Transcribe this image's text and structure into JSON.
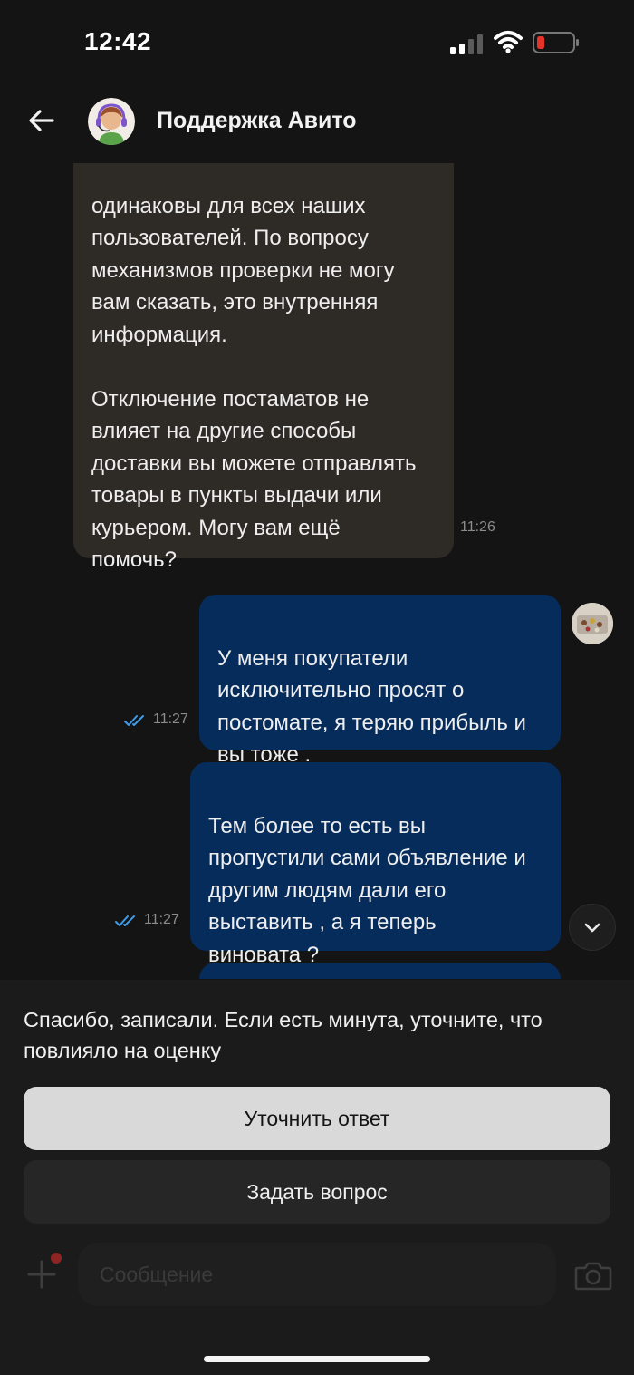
{
  "status_bar": {
    "time": "12:42"
  },
  "header": {
    "title": "Поддержка Авито"
  },
  "messages": [
    {
      "direction": "incoming",
      "text": "одинаковы для всех наших\nпользователей. По вопросу\nмеханизмов проверки не могу\nвам сказать, это внутренняя\nинформация.\n\nОтключение постаматов не\nвлияет на другие способы\nдоставки вы можете отправлять\nтовары в пункты выдачи или\nкурьером. Могу вам ещё\nпомочь?",
      "time": "11:26"
    },
    {
      "direction": "outgoing",
      "text": "У меня покупатели\nисключительно просят о\nпостомате, я теряю прибыль и\nвы тоже .",
      "time": "11:27"
    },
    {
      "direction": "outgoing",
      "text": "Тем более то есть вы\nпропустили сами объявление и\nдругим людям дали его\nвыставить , а я теперь\nвиновата ?",
      "time": "11:27"
    },
    {
      "direction": "outgoing",
      "text": "",
      "time": ""
    }
  ],
  "rating_panel": {
    "text": "Спасибо, записали. Если есть минута, уточните, что повлияло на оценку",
    "primary_button": "Уточнить ответ",
    "secondary_button": "Задать вопрос"
  },
  "composer": {
    "placeholder": "Сообщение"
  },
  "colors": {
    "background": "#141414",
    "incoming_bubble": "#2e2a25",
    "outgoing_bubble": "#062c5c",
    "read_ticks": "#3d9be9",
    "battery_low": "#e5332a"
  },
  "icons": [
    "signal-icon",
    "wifi-icon",
    "battery-icon",
    "back-arrow-icon",
    "double-check-icon",
    "chevron-down-icon",
    "plus-icon",
    "camera-icon"
  ]
}
